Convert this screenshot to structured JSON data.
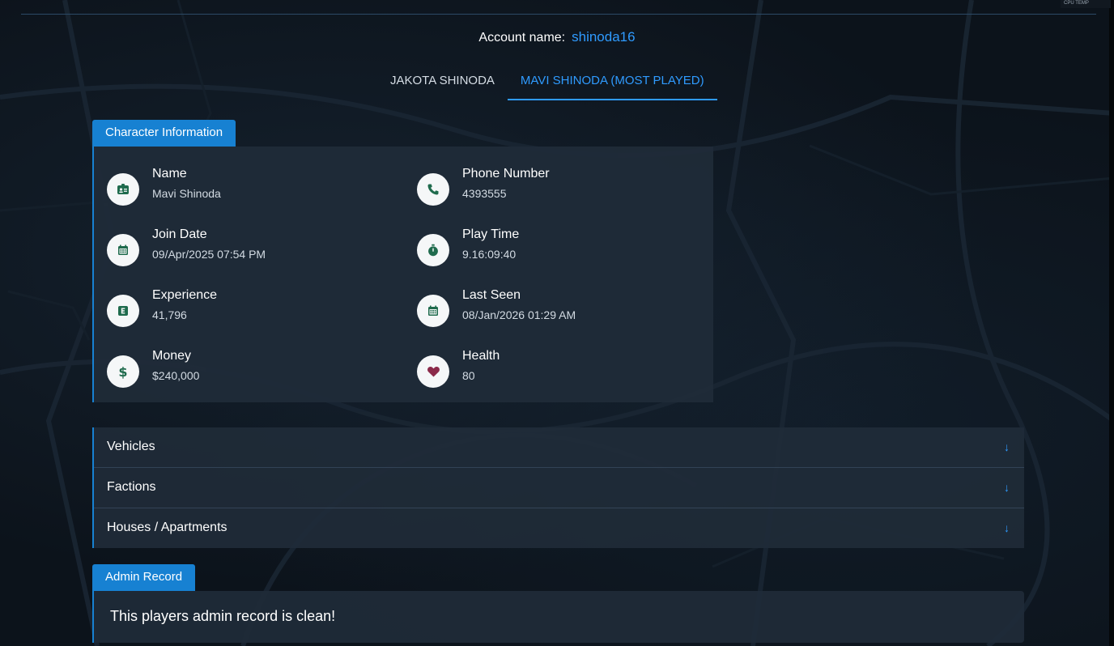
{
  "overlay": {
    "cpu_temp_label": "CPU TEMP"
  },
  "account": {
    "label": "Account name:",
    "value": "shinoda16"
  },
  "tabs": [
    {
      "label": "JAKOTA SHINODA",
      "active": false
    },
    {
      "label": "MAVI SHINODA (MOST PLAYED)",
      "active": true
    }
  ],
  "character_info": {
    "section_title": "Character Information",
    "fields": [
      {
        "title": "Name",
        "value": "Mavi Shinoda",
        "icon": "id-badge-icon"
      },
      {
        "title": "Phone Number",
        "value": "4393555",
        "icon": "phone-icon"
      },
      {
        "title": "Join Date",
        "value": "09/Apr/2025 07:54 PM",
        "icon": "calendar-icon"
      },
      {
        "title": "Play Time",
        "value": "9.16:09:40",
        "icon": "stopwatch-icon"
      },
      {
        "title": "Experience",
        "value": "41,796",
        "icon": "experience-icon"
      },
      {
        "title": "Last Seen",
        "value": "08/Jan/2026 01:29 AM",
        "icon": "calendar-icon"
      },
      {
        "title": "Money",
        "value": "$240,000",
        "icon": "dollar-icon"
      },
      {
        "title": "Health",
        "value": "80",
        "icon": "heart-icon"
      }
    ]
  },
  "accordion": {
    "items": [
      {
        "label": "Vehicles",
        "arrow": "↓"
      },
      {
        "label": "Factions",
        "arrow": "↓"
      },
      {
        "label": "Houses / Apartments",
        "arrow": "↓"
      }
    ]
  },
  "admin_record": {
    "section_title": "Admin Record",
    "text": "This players admin record is clean!"
  },
  "colors": {
    "accent": "#2f9bff",
    "tag_background": "#1781d2",
    "panel_background": "#1f2b38",
    "icon_green": "#1f6b4d",
    "icon_heart": "#8b2a4a"
  }
}
